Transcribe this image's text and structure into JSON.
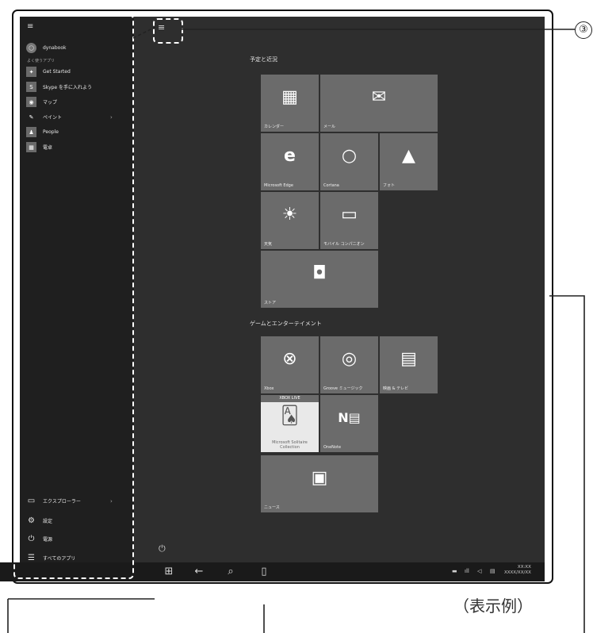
{
  "start_menu": {
    "user": "dynabook",
    "most_used_heading": "よく使うアプリ",
    "apps": [
      {
        "label": "Get Started",
        "icon": "lightbulb-icon",
        "glyph": "✦"
      },
      {
        "label": "Skype を手に入れよう",
        "icon": "skype-icon",
        "glyph": "S"
      },
      {
        "label": "マップ",
        "icon": "map-pin-icon",
        "glyph": "◉"
      },
      {
        "label": "ペイント",
        "icon": "paint-icon",
        "glyph": "✎"
      },
      {
        "label": "People",
        "icon": "people-icon",
        "glyph": "♟"
      },
      {
        "label": "電卓",
        "icon": "calculator-icon",
        "glyph": "▦"
      }
    ],
    "bottom": [
      {
        "label": "エクスプローラー",
        "icon": "file-explorer-icon",
        "glyph": "▭"
      },
      {
        "label": "設定",
        "icon": "settings-gear-icon",
        "glyph": "⚙"
      },
      {
        "label": "電源",
        "icon": "power-icon",
        "glyph": "⏻"
      },
      {
        "label": "すべてのアプリ",
        "icon": "all-apps-icon",
        "glyph": "☰"
      }
    ]
  },
  "groups": {
    "schedule": "予定と近況",
    "games": "ゲームとエンターテイメント"
  },
  "tiles": {
    "calendar": "カレンダー",
    "mail": "メール",
    "edge": "Microsoft Edge",
    "cortana": "Cortana",
    "photos": "フォト",
    "weather": "天気",
    "phone_companion": "モバイル コンパニオン",
    "store": "ストア",
    "xbox": "Xbox",
    "groove": "Groove ミュージック",
    "movies": "映画 & テレビ",
    "xbox_live": "XBOX LIVE",
    "solitaire": "Microsoft Solitaire Collection",
    "onenote": "OneNote",
    "news": "ニュース"
  },
  "taskbar": {
    "clock_time": "XX:XX",
    "clock_date": "XXXX/XX/XX"
  },
  "annotations": {
    "callout_number": "③",
    "caption": "（表示例）"
  },
  "colors": {
    "screen_bg": "#2e2e2e",
    "start_menu_bg": "#1f1f1f",
    "tile_bg": "#6b6b6b",
    "taskbar_bg": "#1a1a1a"
  }
}
